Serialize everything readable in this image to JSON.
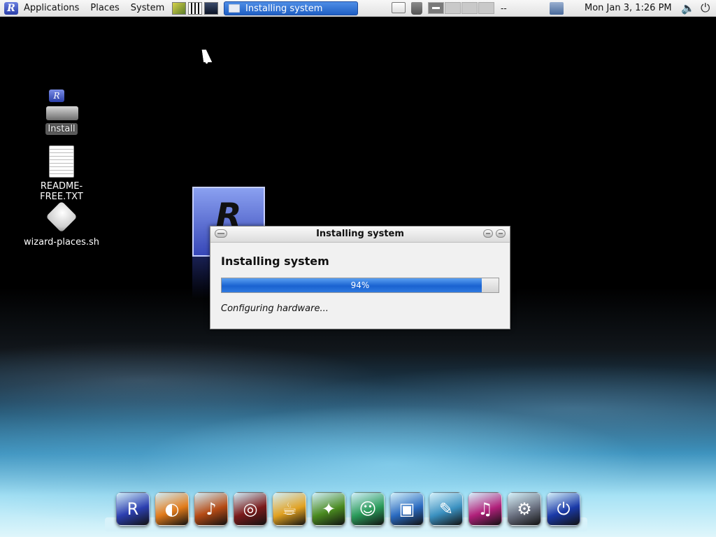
{
  "top_panel": {
    "menus": [
      "Applications",
      "Places",
      "System"
    ],
    "taskbar_title": "Installing system",
    "workspace_label": "--",
    "clock": "Mon Jan  3,  1:26 PM"
  },
  "desktop_icons": [
    {
      "label": "Install",
      "icon": "install-drive-icon"
    },
    {
      "label": "README-FREE.TXT",
      "icon": "text-document-icon"
    },
    {
      "label": "wizard-places.sh",
      "icon": "script-icon"
    }
  ],
  "dialog": {
    "title": "Installing system",
    "heading": "Installing system",
    "progress_fraction": 0.94,
    "progress_text": "94%",
    "status": "Configuring hardware..."
  },
  "dock": [
    {
      "icon": "distro-logo-icon",
      "color": "#2c3fb0"
    },
    {
      "icon": "web-browser-icon",
      "color": "#e07a1a"
    },
    {
      "icon": "guitar-icon",
      "color": "#b44a14"
    },
    {
      "icon": "media-burner-icon",
      "color": "#7a1b1b"
    },
    {
      "icon": "coffee-cup-icon",
      "color": "#e0a020"
    },
    {
      "icon": "game-icon",
      "color": "#4a8a20"
    },
    {
      "icon": "messenger-icon",
      "color": "#2a9a5a"
    },
    {
      "icon": "office-icon",
      "color": "#2a6ac0"
    },
    {
      "icon": "feather-icon",
      "color": "#3a90c0"
    },
    {
      "icon": "music-note-icon",
      "color": "#b0207a"
    },
    {
      "icon": "settings-gear-icon",
      "color": "#6a7080"
    },
    {
      "icon": "power-icon",
      "color": "#1a3aa8"
    }
  ]
}
